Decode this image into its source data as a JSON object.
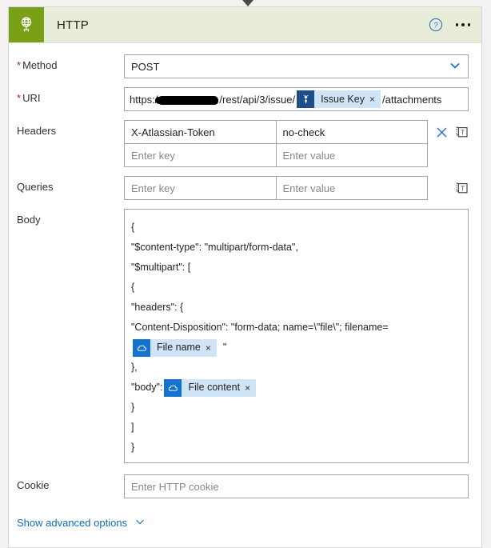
{
  "card": {
    "header": {
      "app_icon": "globe-network-icon",
      "title": "HTTP",
      "help_icon": "help-circle-icon",
      "more_icon": "ellipsis-horizontal-icon"
    },
    "fields": {
      "method": {
        "label": "Method",
        "required": true,
        "value": "POST",
        "chevron": "chevron-down-icon"
      },
      "uri": {
        "label": "URI",
        "required": true,
        "prefix": "https:/",
        "redacted": true,
        "middle": "/rest/api/3/issue/",
        "token": {
          "icon": "jira-icon",
          "label": "Issue Key",
          "remove": "×"
        },
        "suffix": "/attachments"
      },
      "headers": {
        "label": "Headers",
        "rows": [
          {
            "key": "X-Atlassian-Token",
            "value": "no-check",
            "key_is_placeholder": false,
            "value_is_placeholder": false,
            "has_delete": true
          },
          {
            "key": "Enter key",
            "value": "Enter value",
            "key_is_placeholder": true,
            "value_is_placeholder": true,
            "has_delete": false
          }
        ],
        "delete_icon": "close-x-icon",
        "text_mode_icon": "switch-to-text-mode-icon"
      },
      "queries": {
        "label": "Queries",
        "rows": [
          {
            "key": "Enter key",
            "value": "Enter value",
            "key_is_placeholder": true,
            "value_is_placeholder": true,
            "has_delete": false
          }
        ],
        "text_mode_icon": "switch-to-text-mode-icon"
      },
      "body": {
        "label": "Body",
        "lines": [
          {
            "text": "{"
          },
          {
            "text": "\"$content-type\": \"multipart/form-data\","
          },
          {
            "text": "\"$multipart\": ["
          },
          {
            "text": "{"
          },
          {
            "text": "\"headers\": {"
          },
          {
            "text": "\"Content-Disposition\": \"form-data; name=\\\"file\\\"; filename="
          },
          {
            "text": "",
            "token": {
              "icon": "onedrive-cloud-icon",
              "label": "File name",
              "remove": "×"
            },
            "after": "\""
          },
          {
            "text": "},"
          },
          {
            "text": "\"body\": ",
            "token": {
              "icon": "onedrive-cloud-icon",
              "label": "File content",
              "remove": "×"
            },
            "after": ""
          },
          {
            "text": "}"
          },
          {
            "text": "]"
          },
          {
            "text": "}"
          }
        ]
      },
      "cookie": {
        "label": "Cookie",
        "value": "",
        "placeholder": "Enter HTTP cookie"
      }
    },
    "advanced": {
      "label": "Show advanced options",
      "chevron": "chevron-down-icon"
    }
  },
  "colors": {
    "app_tile": "#7aa116",
    "header_bg": "#e7edd9",
    "accent_link": "#0f6cbd",
    "required_asterisk": "#a4262c",
    "token_bg": "#cfe4f7",
    "jira_icon_bg": "#1c4f8a",
    "onedrive_icon_bg": "#1572cf"
  }
}
